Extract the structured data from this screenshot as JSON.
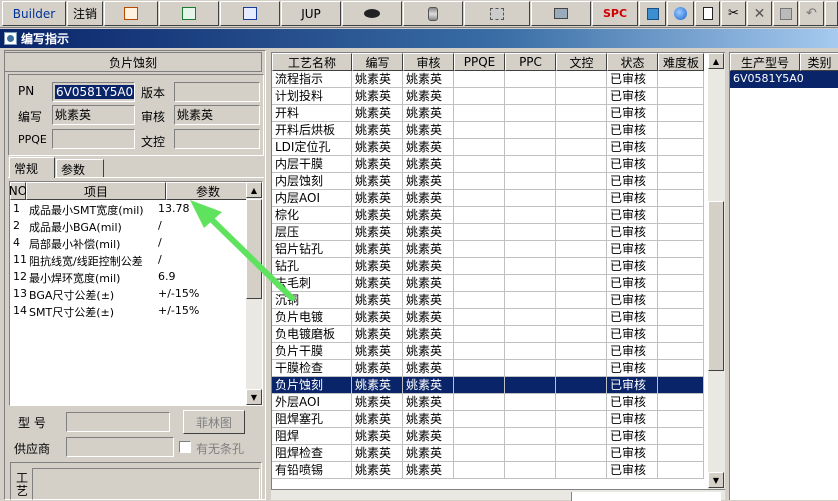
{
  "toolbar": {
    "builder": "Builder",
    "logout": "注销",
    "jup": "JUP",
    "spc": "SPC"
  },
  "window": {
    "title": "编写指示"
  },
  "header": {
    "process_title": "负片蚀刻"
  },
  "form": {
    "pn_label": "PN",
    "pn_value": "6V0581Y5A0",
    "version_label": "版本",
    "version_value": "",
    "author_label": "编写",
    "author_value": "姚素英",
    "reviewer_label": "审核",
    "reviewer_value": "姚素英",
    "ppqe_label": "PPQE",
    "ppqe_value": "",
    "doc_label": "文控",
    "doc_value": ""
  },
  "tabs": [
    {
      "label": "常规"
    },
    {
      "label": "参数"
    }
  ],
  "param_grid": {
    "headers": {
      "no": "NO",
      "item": "项目",
      "param": "参数"
    },
    "rows": [
      {
        "no": "1",
        "item": "成品最小SMT宽度(mil)",
        "param": "13.78"
      },
      {
        "no": "2",
        "item": "成品最小BGA(mil)",
        "param": "/"
      },
      {
        "no": "4",
        "item": "局部最小补偿(mil)",
        "param": "/"
      },
      {
        "no": "11",
        "item": "阻抗线宽/线距控制公差",
        "param": "/"
      },
      {
        "no": "12",
        "item": "最小焊环宽度(mil)",
        "param": "6.9"
      },
      {
        "no": "13",
        "item": "BGA尺寸公差(±)",
        "param": "+/-15%"
      },
      {
        "no": "14",
        "item": "SMT尺寸公差(±)",
        "param": "+/-15%"
      }
    ]
  },
  "bottom_form": {
    "model_label": "型 号",
    "model_value": "",
    "film_button": "菲林图",
    "supplier_label": "供应商",
    "supplier_value": "",
    "barcode_hole_label": "有无条孔",
    "process_label": "工艺"
  },
  "main_grid": {
    "headers": [
      "工艺名称",
      "编写",
      "审核",
      "PPQE",
      "PPC",
      "文控",
      "状态",
      "难度板"
    ],
    "rows": [
      {
        "name": "流程指示",
        "author": "姚素英",
        "reviewer": "姚素英",
        "status": "已审核"
      },
      {
        "name": "计划投料",
        "author": "姚素英",
        "reviewer": "姚素英",
        "status": "已审核"
      },
      {
        "name": "开料",
        "author": "姚素英",
        "reviewer": "姚素英",
        "status": "已审核"
      },
      {
        "name": "开料后烘板",
        "author": "姚素英",
        "reviewer": "姚素英",
        "status": "已审核"
      },
      {
        "name": "LDI定位孔",
        "author": "姚素英",
        "reviewer": "姚素英",
        "status": "已审核"
      },
      {
        "name": "内层干膜",
        "author": "姚素英",
        "reviewer": "姚素英",
        "status": "已审核"
      },
      {
        "name": "内层蚀刻",
        "author": "姚素英",
        "reviewer": "姚素英",
        "status": "已审核"
      },
      {
        "name": "内层AOI",
        "author": "姚素英",
        "reviewer": "姚素英",
        "status": "已审核"
      },
      {
        "name": "棕化",
        "author": "姚素英",
        "reviewer": "姚素英",
        "status": "已审核"
      },
      {
        "name": "层压",
        "author": "姚素英",
        "reviewer": "姚素英",
        "status": "已审核"
      },
      {
        "name": "铝片钻孔",
        "author": "姚素英",
        "reviewer": "姚素英",
        "status": "已审核"
      },
      {
        "name": "钻孔",
        "author": "姚素英",
        "reviewer": "姚素英",
        "status": "已审核"
      },
      {
        "name": "去毛刺",
        "author": "姚素英",
        "reviewer": "姚素英",
        "status": "已审核"
      },
      {
        "name": "沉铜",
        "author": "姚素英",
        "reviewer": "姚素英",
        "status": "已审核"
      },
      {
        "name": "负片电镀",
        "author": "姚素英",
        "reviewer": "姚素英",
        "status": "已审核"
      },
      {
        "name": "负电镀磨板",
        "author": "姚素英",
        "reviewer": "姚素英",
        "status": "已审核"
      },
      {
        "name": "负片干膜",
        "author": "姚素英",
        "reviewer": "姚素英",
        "status": "已审核"
      },
      {
        "name": "干膜检查",
        "author": "姚素英",
        "reviewer": "姚素英",
        "status": "已审核"
      },
      {
        "name": "负片蚀刻",
        "author": "姚素英",
        "reviewer": "姚素英",
        "status": "已审核"
      },
      {
        "name": "外层AOI",
        "author": "姚素英",
        "reviewer": "姚素英",
        "status": "已审核"
      },
      {
        "name": "阻焊塞孔",
        "author": "姚素英",
        "reviewer": "姚素英",
        "status": "已审核"
      },
      {
        "name": "阻焊",
        "author": "姚素英",
        "reviewer": "姚素英",
        "status": "已审核"
      },
      {
        "name": "阻焊检查",
        "author": "姚素英",
        "reviewer": "姚素英",
        "status": "已审核"
      },
      {
        "name": "有铅喷锡",
        "author": "姚素英",
        "reviewer": "姚素英",
        "status": "已审核"
      }
    ],
    "selected_index": 18
  },
  "right_grid": {
    "headers": [
      "生产型号",
      "类别"
    ],
    "rows": [
      {
        "model": "6V0581Y5A0",
        "category": ""
      }
    ]
  },
  "annotation": {
    "arrow_color": "#5fe35f"
  },
  "colors": {
    "selection": "#0a246a",
    "face": "#d4d0c8"
  }
}
